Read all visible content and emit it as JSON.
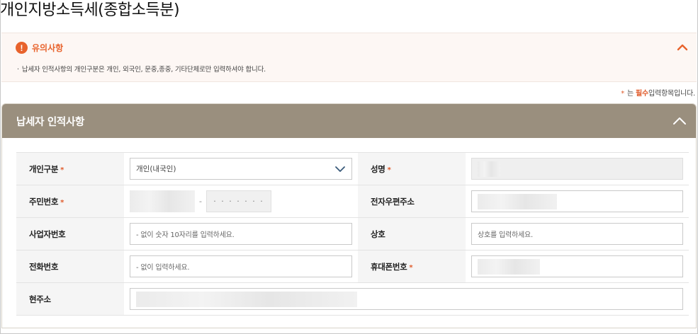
{
  "page": {
    "title": "개인지방소득세(종합소득분)"
  },
  "notice": {
    "icon": "warning-icon",
    "icon_glyph": "!",
    "title": "유의사항",
    "bullet": "·",
    "text": "납세자 인적사항의 개인구분은 개인, 외국인, 문중,종중, 기타단체로만 입력하셔야 합니다.",
    "toggle_icon": "chevron-up-icon"
  },
  "required_legend": {
    "star": "*",
    "prefix": "는",
    "emphasis": "필수",
    "suffix": "입력항목입니다."
  },
  "section": {
    "title": "납세자 인적사항",
    "toggle_icon": "chevron-up-icon"
  },
  "form": {
    "required_star": "*",
    "individual_type": {
      "label": "개인구분",
      "value": "개인(내국인)"
    },
    "name": {
      "label": "성명"
    },
    "resident_number": {
      "label": "주민번호",
      "dash": "-",
      "back_mask": "· · · · · · ·"
    },
    "email": {
      "label": "전자우편주소"
    },
    "business_number": {
      "label": "사업자번호",
      "placeholder": "- 없이 숫자 10자리를 입력하세요."
    },
    "company_name": {
      "label": "상호",
      "placeholder": "상호를 입력하세요."
    },
    "phone": {
      "label": "전화번호",
      "placeholder": "- 없이 입력하세요."
    },
    "mobile": {
      "label": "휴대폰번호"
    },
    "address": {
      "label": "현주소"
    }
  },
  "colors": {
    "accent": "#e8632c",
    "section_header": "#9a8f7e",
    "notice_bg": "#fdf7f4",
    "label_bg": "#f5f5f5"
  }
}
